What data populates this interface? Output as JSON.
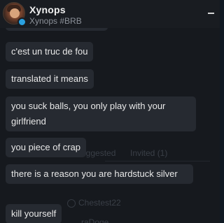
{
  "header": {
    "name": "Xynops",
    "tag": "Xynops #BRB",
    "minimize_icon": "minimize-icon",
    "status_color": "#2aa1e0"
  },
  "messages": [
    {
      "text": "c'est un truc de fou"
    },
    {
      "text": "translated it means"
    },
    {
      "text": "you suck balls, you only play with your girlfriend"
    },
    {
      "text": "you piece of crap"
    },
    {
      "text": "there is a reason you are hardstuck silver"
    },
    {
      "text": "kill yourself"
    }
  ],
  "background_ghost": {
    "suggested": "Suggested",
    "invited": "Invited (1)",
    "friend1": "Chestest22",
    "friend2": "raDoge"
  }
}
